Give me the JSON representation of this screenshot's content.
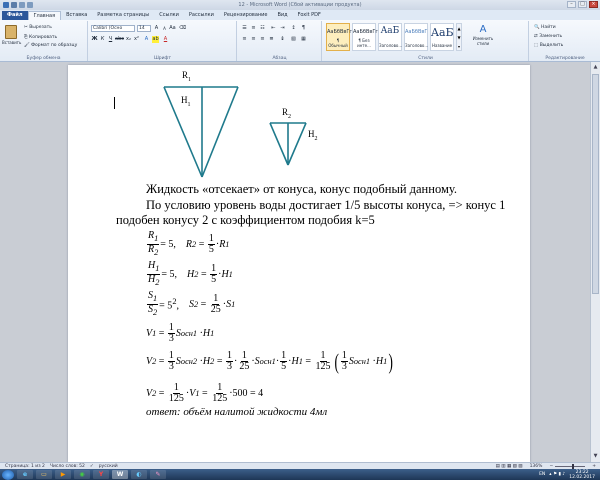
{
  "window": {
    "title": "12 - Microsoft Word (Сбой активации продукта)"
  },
  "tabs": [
    {
      "label": "Файл"
    },
    {
      "label": "Главная"
    },
    {
      "label": "Вставка"
    },
    {
      "label": "Разметка страницы"
    },
    {
      "label": "Ссылки"
    },
    {
      "label": "Рассылки"
    },
    {
      "label": "Рецензирование"
    },
    {
      "label": "Вид"
    },
    {
      "label": "Foxit PDF"
    }
  ],
  "ribbon": {
    "clipboard": {
      "paste": "Вставить",
      "cut": "Вырезать",
      "copy": "Копировать",
      "format": "Формат по образцу",
      "label": "Буфер обмена"
    },
    "font": {
      "name": "Calibri (Осно",
      "size": "14",
      "label": "Шрифт"
    },
    "paragraph": {
      "label": "Абзац"
    },
    "styles": {
      "items": [
        {
          "sample": "AaБбВвГг,",
          "name": "¶ Обычный"
        },
        {
          "sample": "AaБбВвГг,",
          "name": "¶ Без инте..."
        },
        {
          "sample": "AaБ",
          "name": "Заголово..."
        },
        {
          "sample": "AaБбВвГ",
          "name": "Заголово..."
        },
        {
          "sample": "AaБ",
          "name": "Название"
        }
      ],
      "change": "Изменить стили",
      "label": "Стили"
    },
    "editing": {
      "find": "Найти",
      "replace": "Заменить",
      "select": "Выделить",
      "label": "Редактирование"
    }
  },
  "figure": {
    "r1": "R",
    "r1_sub": "1",
    "h1": "H",
    "h1_sub": "1",
    "r2": "R",
    "r2_sub": "2",
    "h2": "H",
    "h2_sub": "2"
  },
  "doc": {
    "line1": "Жидкость «отсекает» от конуса, конус подобный данному.",
    "line2": "По условию уровень воды достигает 1/5 высоты конуса, => конус 1",
    "line3": "подобен конусу 2 с коэффициентом подобия k=5",
    "answer": "ответ:     объём налитой жидкости 4мл"
  },
  "status": {
    "page": "Страница: 1 из 2",
    "words": "Число слов: 52",
    "lang": "русский",
    "zoom": "136%"
  },
  "tray": {
    "lang": "EN",
    "time": "23:22",
    "date": "12.02.2017"
  }
}
